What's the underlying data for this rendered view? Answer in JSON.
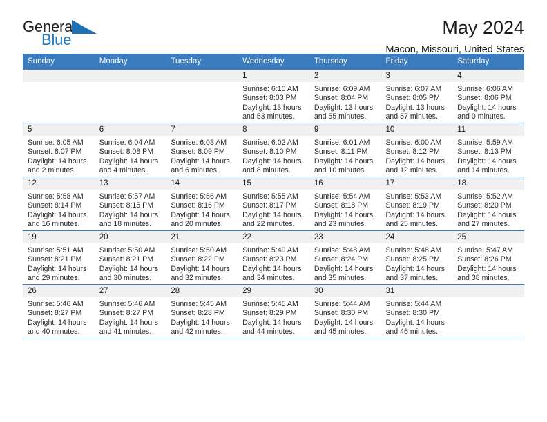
{
  "brand": {
    "name_part1": "General",
    "name_part2": "Blue",
    "triangle_color": "#1f6fb4",
    "blue_color": "#1f7ac0"
  },
  "header": {
    "title": "May 2024",
    "subtitle": "Macon, Missouri, United States"
  },
  "theme": {
    "header_bar_color": "#3a7cbe",
    "daynum_band_color": "#f0f0f0",
    "text_color": "#1a1a1a"
  },
  "weekday_headers": [
    "Sunday",
    "Monday",
    "Tuesday",
    "Wednesday",
    "Thursday",
    "Friday",
    "Saturday"
  ],
  "weeks": [
    [
      {
        "day": "",
        "sunrise": "",
        "sunset": "",
        "daylight_line1": "",
        "daylight_line2": ""
      },
      {
        "day": "",
        "sunrise": "",
        "sunset": "",
        "daylight_line1": "",
        "daylight_line2": ""
      },
      {
        "day": "",
        "sunrise": "",
        "sunset": "",
        "daylight_line1": "",
        "daylight_line2": ""
      },
      {
        "day": "1",
        "sunrise": "Sunrise: 6:10 AM",
        "sunset": "Sunset: 8:03 PM",
        "daylight_line1": "Daylight: 13 hours",
        "daylight_line2": "and 53 minutes."
      },
      {
        "day": "2",
        "sunrise": "Sunrise: 6:09 AM",
        "sunset": "Sunset: 8:04 PM",
        "daylight_line1": "Daylight: 13 hours",
        "daylight_line2": "and 55 minutes."
      },
      {
        "day": "3",
        "sunrise": "Sunrise: 6:07 AM",
        "sunset": "Sunset: 8:05 PM",
        "daylight_line1": "Daylight: 13 hours",
        "daylight_line2": "and 57 minutes."
      },
      {
        "day": "4",
        "sunrise": "Sunrise: 6:06 AM",
        "sunset": "Sunset: 8:06 PM",
        "daylight_line1": "Daylight: 14 hours",
        "daylight_line2": "and 0 minutes."
      }
    ],
    [
      {
        "day": "5",
        "sunrise": "Sunrise: 6:05 AM",
        "sunset": "Sunset: 8:07 PM",
        "daylight_line1": "Daylight: 14 hours",
        "daylight_line2": "and 2 minutes."
      },
      {
        "day": "6",
        "sunrise": "Sunrise: 6:04 AM",
        "sunset": "Sunset: 8:08 PM",
        "daylight_line1": "Daylight: 14 hours",
        "daylight_line2": "and 4 minutes."
      },
      {
        "day": "7",
        "sunrise": "Sunrise: 6:03 AM",
        "sunset": "Sunset: 8:09 PM",
        "daylight_line1": "Daylight: 14 hours",
        "daylight_line2": "and 6 minutes."
      },
      {
        "day": "8",
        "sunrise": "Sunrise: 6:02 AM",
        "sunset": "Sunset: 8:10 PM",
        "daylight_line1": "Daylight: 14 hours",
        "daylight_line2": "and 8 minutes."
      },
      {
        "day": "9",
        "sunrise": "Sunrise: 6:01 AM",
        "sunset": "Sunset: 8:11 PM",
        "daylight_line1": "Daylight: 14 hours",
        "daylight_line2": "and 10 minutes."
      },
      {
        "day": "10",
        "sunrise": "Sunrise: 6:00 AM",
        "sunset": "Sunset: 8:12 PM",
        "daylight_line1": "Daylight: 14 hours",
        "daylight_line2": "and 12 minutes."
      },
      {
        "day": "11",
        "sunrise": "Sunrise: 5:59 AM",
        "sunset": "Sunset: 8:13 PM",
        "daylight_line1": "Daylight: 14 hours",
        "daylight_line2": "and 14 minutes."
      }
    ],
    [
      {
        "day": "12",
        "sunrise": "Sunrise: 5:58 AM",
        "sunset": "Sunset: 8:14 PM",
        "daylight_line1": "Daylight: 14 hours",
        "daylight_line2": "and 16 minutes."
      },
      {
        "day": "13",
        "sunrise": "Sunrise: 5:57 AM",
        "sunset": "Sunset: 8:15 PM",
        "daylight_line1": "Daylight: 14 hours",
        "daylight_line2": "and 18 minutes."
      },
      {
        "day": "14",
        "sunrise": "Sunrise: 5:56 AM",
        "sunset": "Sunset: 8:16 PM",
        "daylight_line1": "Daylight: 14 hours",
        "daylight_line2": "and 20 minutes."
      },
      {
        "day": "15",
        "sunrise": "Sunrise: 5:55 AM",
        "sunset": "Sunset: 8:17 PM",
        "daylight_line1": "Daylight: 14 hours",
        "daylight_line2": "and 22 minutes."
      },
      {
        "day": "16",
        "sunrise": "Sunrise: 5:54 AM",
        "sunset": "Sunset: 8:18 PM",
        "daylight_line1": "Daylight: 14 hours",
        "daylight_line2": "and 23 minutes."
      },
      {
        "day": "17",
        "sunrise": "Sunrise: 5:53 AM",
        "sunset": "Sunset: 8:19 PM",
        "daylight_line1": "Daylight: 14 hours",
        "daylight_line2": "and 25 minutes."
      },
      {
        "day": "18",
        "sunrise": "Sunrise: 5:52 AM",
        "sunset": "Sunset: 8:20 PM",
        "daylight_line1": "Daylight: 14 hours",
        "daylight_line2": "and 27 minutes."
      }
    ],
    [
      {
        "day": "19",
        "sunrise": "Sunrise: 5:51 AM",
        "sunset": "Sunset: 8:21 PM",
        "daylight_line1": "Daylight: 14 hours",
        "daylight_line2": "and 29 minutes."
      },
      {
        "day": "20",
        "sunrise": "Sunrise: 5:50 AM",
        "sunset": "Sunset: 8:21 PM",
        "daylight_line1": "Daylight: 14 hours",
        "daylight_line2": "and 30 minutes."
      },
      {
        "day": "21",
        "sunrise": "Sunrise: 5:50 AM",
        "sunset": "Sunset: 8:22 PM",
        "daylight_line1": "Daylight: 14 hours",
        "daylight_line2": "and 32 minutes."
      },
      {
        "day": "22",
        "sunrise": "Sunrise: 5:49 AM",
        "sunset": "Sunset: 8:23 PM",
        "daylight_line1": "Daylight: 14 hours",
        "daylight_line2": "and 34 minutes."
      },
      {
        "day": "23",
        "sunrise": "Sunrise: 5:48 AM",
        "sunset": "Sunset: 8:24 PM",
        "daylight_line1": "Daylight: 14 hours",
        "daylight_line2": "and 35 minutes."
      },
      {
        "day": "24",
        "sunrise": "Sunrise: 5:48 AM",
        "sunset": "Sunset: 8:25 PM",
        "daylight_line1": "Daylight: 14 hours",
        "daylight_line2": "and 37 minutes."
      },
      {
        "day": "25",
        "sunrise": "Sunrise: 5:47 AM",
        "sunset": "Sunset: 8:26 PM",
        "daylight_line1": "Daylight: 14 hours",
        "daylight_line2": "and 38 minutes."
      }
    ],
    [
      {
        "day": "26",
        "sunrise": "Sunrise: 5:46 AM",
        "sunset": "Sunset: 8:27 PM",
        "daylight_line1": "Daylight: 14 hours",
        "daylight_line2": "and 40 minutes."
      },
      {
        "day": "27",
        "sunrise": "Sunrise: 5:46 AM",
        "sunset": "Sunset: 8:27 PM",
        "daylight_line1": "Daylight: 14 hours",
        "daylight_line2": "and 41 minutes."
      },
      {
        "day": "28",
        "sunrise": "Sunrise: 5:45 AM",
        "sunset": "Sunset: 8:28 PM",
        "daylight_line1": "Daylight: 14 hours",
        "daylight_line2": "and 42 minutes."
      },
      {
        "day": "29",
        "sunrise": "Sunrise: 5:45 AM",
        "sunset": "Sunset: 8:29 PM",
        "daylight_line1": "Daylight: 14 hours",
        "daylight_line2": "and 44 minutes."
      },
      {
        "day": "30",
        "sunrise": "Sunrise: 5:44 AM",
        "sunset": "Sunset: 8:30 PM",
        "daylight_line1": "Daylight: 14 hours",
        "daylight_line2": "and 45 minutes."
      },
      {
        "day": "31",
        "sunrise": "Sunrise: 5:44 AM",
        "sunset": "Sunset: 8:30 PM",
        "daylight_line1": "Daylight: 14 hours",
        "daylight_line2": "and 46 minutes."
      },
      {
        "day": "",
        "sunrise": "",
        "sunset": "",
        "daylight_line1": "",
        "daylight_line2": ""
      }
    ]
  ]
}
